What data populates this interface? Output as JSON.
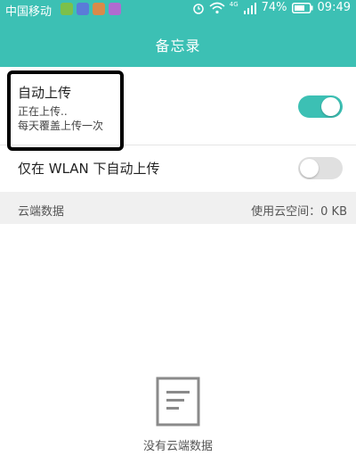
{
  "status_bar": {
    "carrier": "中国移动",
    "battery": "74%",
    "time": "09:49",
    "network_label": "4G",
    "icons": [
      "app-icon-green",
      "app-icon-blue",
      "app-icon-orange",
      "app-icon-purple",
      "alarm-icon",
      "wifi-icon",
      "signal-icon",
      "battery-icon"
    ]
  },
  "header": {
    "title": "备忘录"
  },
  "auto_upload": {
    "label": "自动上传",
    "status": "正在上传..",
    "frequency": "每天覆盖上传一次",
    "enabled": true
  },
  "wlan_upload": {
    "label": "仅在 WLAN 下自动上传",
    "enabled": false
  },
  "cloud_section": {
    "title": "云端数据",
    "usage": "使用云空间：0 KB"
  },
  "empty_state": {
    "text": "没有云端数据",
    "icon": "document-icon"
  },
  "colors": {
    "accent": "#3cc0b4",
    "section_bg": "#f0f0f0",
    "toggle_off": "#e0e0e0"
  }
}
